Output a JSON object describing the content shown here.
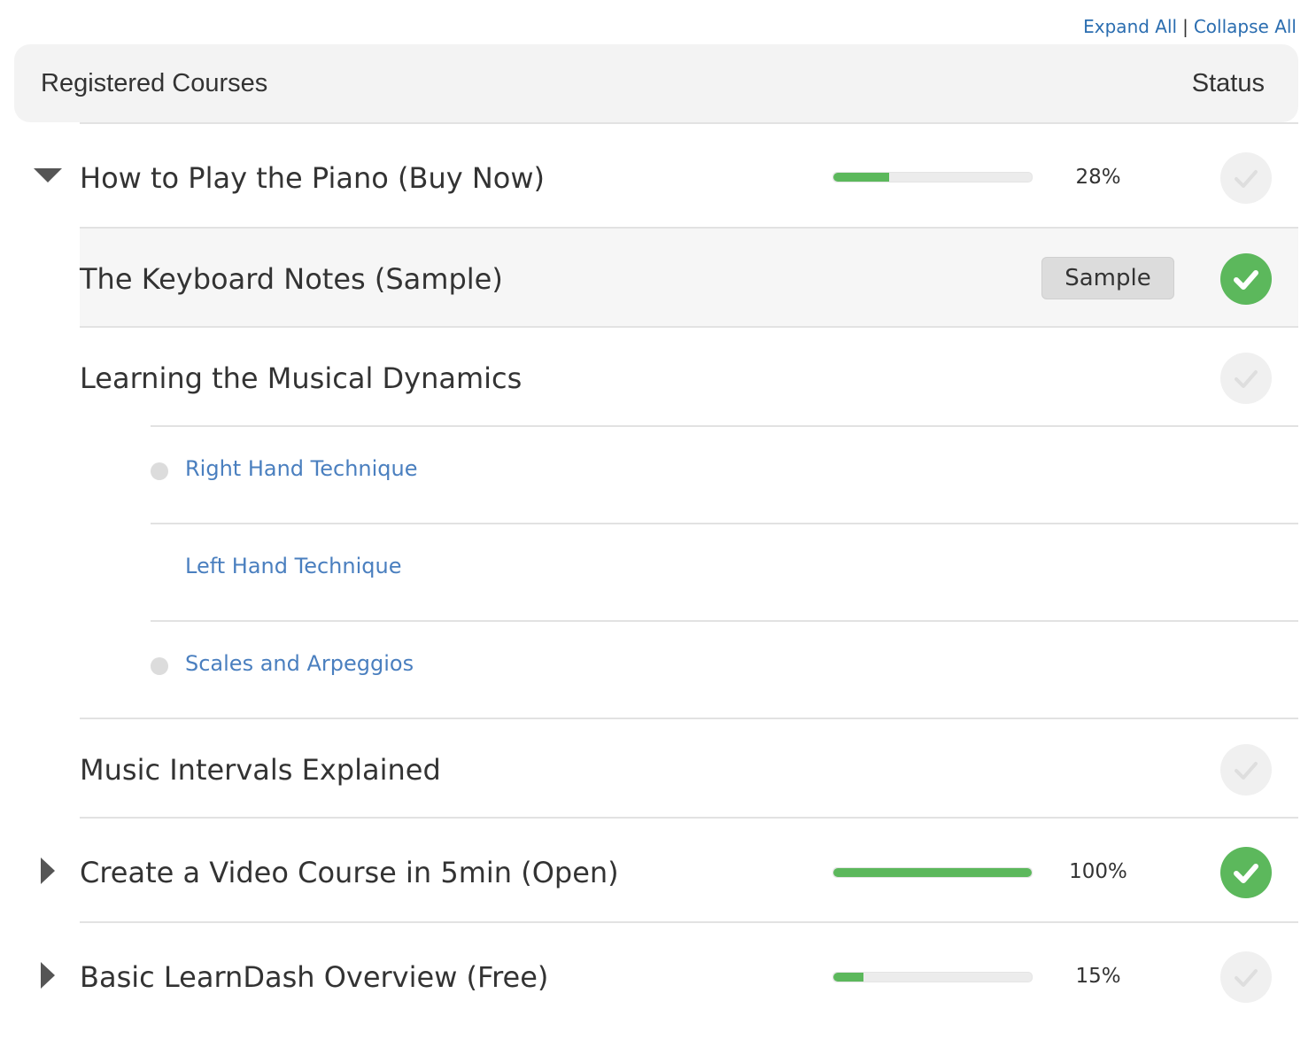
{
  "top_links": {
    "expand_all": "Expand All",
    "separator": "|",
    "collapse_all": "Collapse All"
  },
  "header": {
    "title": "Registered Courses",
    "status": "Status"
  },
  "colors": {
    "link": "#2a6db0",
    "topic_link": "#4a7fbf",
    "progress_fill": "#5cb85c",
    "complete_icon": "#5cb85c",
    "incomplete_icon": "#f0f0f0"
  },
  "courses": [
    {
      "title": "How to Play the Piano (Buy Now)",
      "expanded": true,
      "progress": 28,
      "progress_label": "28%",
      "status_icon": "check-icon",
      "completed": false,
      "lessons": [
        {
          "title": "The Keyboard Notes (Sample)",
          "badge": "Sample",
          "completed": true
        },
        {
          "title": "Learning the Musical Dynamics",
          "completed": false,
          "topics": [
            {
              "title": "Right Hand Technique",
              "dot": true
            },
            {
              "title": "Left Hand Technique",
              "dot": false
            },
            {
              "title": "Scales and Arpeggios",
              "dot": true
            }
          ]
        },
        {
          "title": "Music Intervals Explained",
          "completed": false
        }
      ]
    },
    {
      "title": "Create a Video Course in 5min (Open)",
      "expanded": false,
      "progress": 100,
      "progress_label": "100%",
      "status_icon": "check-icon",
      "completed": true
    },
    {
      "title": "Basic LearnDash Overview (Free)",
      "expanded": false,
      "progress": 15,
      "progress_label": "15%",
      "status_icon": "check-icon",
      "completed": false
    }
  ]
}
